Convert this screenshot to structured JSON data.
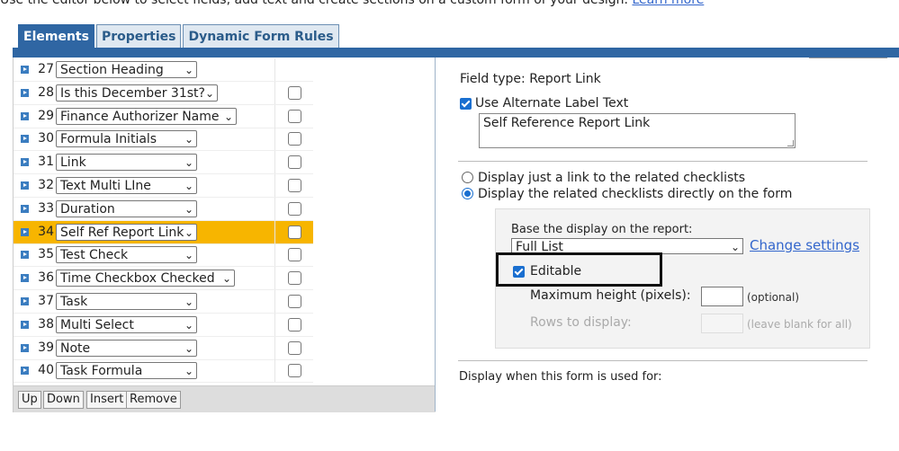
{
  "intro": {
    "text": "Use the editor below to select fields, add text and create sections on a custom form of your design.",
    "link": "Learn more"
  },
  "tabs": [
    "Elements",
    "Properties",
    "Dynamic Form Rules"
  ],
  "fields": [
    {
      "num": "27",
      "label": "Section Heading",
      "checkbox": false
    },
    {
      "num": "28",
      "label": "Is this December 31st?",
      "checkbox": true
    },
    {
      "num": "29",
      "label": "Finance Authorizer Name",
      "checkbox": true
    },
    {
      "num": "30",
      "label": "Formula Initials",
      "checkbox": true
    },
    {
      "num": "31",
      "label": "Link",
      "checkbox": true
    },
    {
      "num": "32",
      "label": "Text Multi LIne",
      "checkbox": true
    },
    {
      "num": "33",
      "label": "Duration",
      "checkbox": true
    },
    {
      "num": "34",
      "label": "Self Ref Report Link",
      "checkbox": true,
      "selected": true
    },
    {
      "num": "35",
      "label": "Test Check",
      "checkbox": true
    },
    {
      "num": "36",
      "label": "Time Checkbox Checked",
      "checkbox": true
    },
    {
      "num": "37",
      "label": "Task",
      "checkbox": true
    },
    {
      "num": "38",
      "label": "Multi Select",
      "checkbox": true
    },
    {
      "num": "39",
      "label": "Note",
      "checkbox": true
    },
    {
      "num": "40",
      "label": "Task Formula",
      "checkbox": true
    }
  ],
  "buttons": {
    "up": "Up",
    "down": "Down",
    "insert": "Insert",
    "remove": "Remove"
  },
  "properties": {
    "field_type": "Field type: Report Link",
    "use_alt_label": "Use Alternate Label Text",
    "alt_label_value": "Self Reference Report Link",
    "radio_link": "Display just a link to the related checklists",
    "radio_direct": "Display the related checklists directly on the form",
    "base_display": "Base the display on the report:",
    "report_value": "Full List",
    "change_settings": "Change settings",
    "editable": "Editable",
    "max_height_label": "Maximum height (pixels):",
    "optional": "(optional)",
    "rows_label": "Rows to display:",
    "rows_hint": "(leave blank for all)",
    "display_when": "Display when this form is used for:"
  },
  "colors": {
    "accent": "#2f66a3",
    "selected_row": "#f7b500",
    "link": "#3366cc"
  }
}
